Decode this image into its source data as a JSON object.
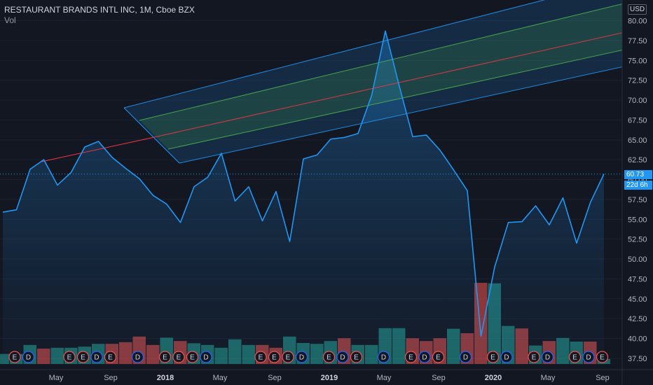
{
  "header": {
    "title": "RESTAURANT BRANDS INTL INC, 1M, Cboe BZX",
    "volume_label": "Vol",
    "currency": "USD"
  },
  "last_price": {
    "value": "60.73",
    "countdown": "22d 6h"
  },
  "colors": {
    "background": "#131722",
    "price_line": "#2196f3",
    "volume_up": "#26a69a",
    "volume_down": "#ef5350",
    "channel_outer": "#2196f3",
    "channel_inner": "#4caf50",
    "channel_median": "#f23645",
    "earnings_marker": "#ef5350",
    "dividend_marker": "#2962ff"
  },
  "chart_data": {
    "type": "line",
    "title": "RESTAURANT BRANDS INTL INC, 1M, Cboe BZX",
    "ylabel": "USD",
    "ylim": [
      36.7,
      82.6
    ],
    "y_ticks": [
      "37.50",
      "40.00",
      "42.50",
      "45.00",
      "47.50",
      "50.00",
      "52.50",
      "55.00",
      "57.50",
      "60.00",
      "62.50",
      "65.00",
      "67.50",
      "70.00",
      "72.50",
      "75.00",
      "77.50",
      "80.00"
    ],
    "x_tick_labels": [
      {
        "label": "May",
        "index": 2
      },
      {
        "label": "Sep",
        "index": 6
      },
      {
        "label": "2018",
        "index": 10
      },
      {
        "label": "May",
        "index": 14
      },
      {
        "label": "Sep",
        "index": 18
      },
      {
        "label": "2019",
        "index": 22
      },
      {
        "label": "May",
        "index": 26
      },
      {
        "label": "Sep",
        "index": 30
      },
      {
        "label": "2020",
        "index": 34
      },
      {
        "label": "May",
        "index": 38
      },
      {
        "label": "Sep",
        "index": 42
      }
    ],
    "series": [
      {
        "values": [
          55.9,
          56.2,
          61.3,
          62.5,
          59.3,
          60.9,
          64.1,
          64.8,
          62.8,
          61.4,
          60.1,
          58.0,
          56.9,
          54.6,
          59.1,
          60.3,
          63.3,
          57.3,
          59.1,
          54.8,
          58.5,
          52.2,
          62.6,
          63.1,
          65.1,
          65.3,
          65.8,
          70.6,
          78.7,
          71.9,
          65.4,
          65.6,
          63.7,
          61.2,
          58.6,
          40.3,
          49.0,
          54.6,
          54.7,
          56.7,
          54.3,
          57.7,
          52.0,
          57.1,
          60.7
        ]
      }
    ],
    "volume_up": [
      true,
      true,
      true,
      false,
      true,
      true,
      true,
      true,
      false,
      false,
      false,
      false,
      true,
      false,
      true,
      true,
      true,
      true,
      true,
      false,
      false,
      true,
      true,
      true,
      true,
      false,
      true,
      true,
      true,
      true,
      false,
      false,
      false,
      true,
      false,
      false,
      true,
      true,
      false,
      true,
      false,
      true,
      true,
      false,
      true,
      true
    ],
    "volume_relative": [
      0.36,
      0.36,
      0.68,
      0.55,
      0.58,
      0.58,
      0.62,
      0.72,
      0.72,
      0.78,
      0.98,
      0.68,
      0.94,
      0.82,
      0.74,
      0.68,
      0.58,
      0.88,
      0.68,
      0.68,
      0.58,
      0.98,
      0.75,
      0.72,
      0.82,
      0.92,
      0.68,
      0.68,
      1.28,
      1.28,
      0.92,
      0.82,
      0.92,
      1.26,
      1.1,
      2.9,
      2.88,
      1.36,
      1.27,
      0.66,
      0.82,
      0.93,
      0.8,
      0.8,
      0.18
    ],
    "event_markers": [
      {
        "type": "E",
        "index": 0
      },
      {
        "type": "D",
        "index": 1
      },
      {
        "type": "E",
        "index": 4
      },
      {
        "type": "E",
        "index": 5
      },
      {
        "type": "D",
        "index": 6
      },
      {
        "type": "E",
        "index": 7
      },
      {
        "type": "D",
        "index": 9
      },
      {
        "type": "E",
        "index": 11
      },
      {
        "type": "E",
        "index": 12
      },
      {
        "type": "E",
        "index": 13
      },
      {
        "type": "D",
        "index": 14
      },
      {
        "type": "E",
        "index": 18
      },
      {
        "type": "E",
        "index": 19
      },
      {
        "type": "E",
        "index": 20
      },
      {
        "type": "D",
        "index": 21
      },
      {
        "type": "E",
        "index": 23
      },
      {
        "type": "D",
        "index": 24
      },
      {
        "type": "E",
        "index": 25
      },
      {
        "type": "D",
        "index": 27
      },
      {
        "type": "E",
        "index": 29
      },
      {
        "type": "D",
        "index": 30
      },
      {
        "type": "E",
        "index": 31
      },
      {
        "type": "D",
        "index": 33
      },
      {
        "type": "E",
        "index": 35
      },
      {
        "type": "D",
        "index": 36
      },
      {
        "type": "E",
        "index": 38
      },
      {
        "type": "D",
        "index": 39
      },
      {
        "type": "E",
        "index": 41
      },
      {
        "type": "D",
        "index": 42
      },
      {
        "type": "E",
        "index": 43
      }
    ]
  }
}
